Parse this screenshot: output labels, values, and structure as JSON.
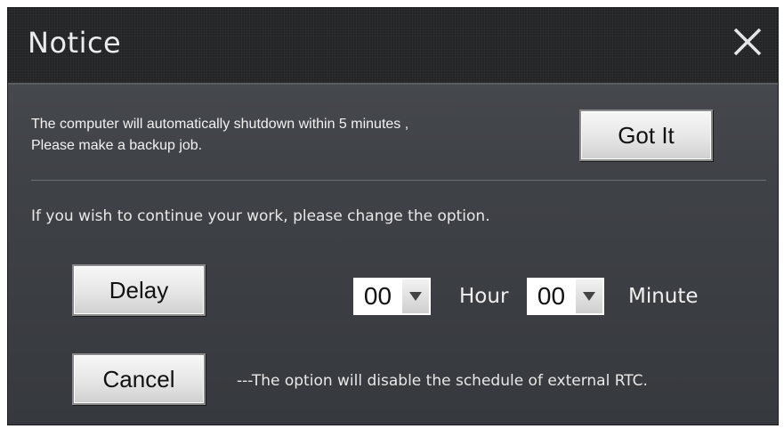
{
  "dialog": {
    "title": "Notice",
    "close_icon": "close-icon"
  },
  "message": {
    "line1": "The computer will automatically shutdown within 5 minutes ,",
    "line2": "Please make a backup job.",
    "got_it_label": "Got It"
  },
  "option_text": "If you wish to continue your work, please change the option.",
  "delay": {
    "button_label": "Delay",
    "hour_value": "00",
    "hour_label": "Hour",
    "minute_value": "00",
    "minute_label": "Minute",
    "dropdown_icon": "triangle-down-icon"
  },
  "cancel": {
    "button_label": "Cancel",
    "note": "---The option will disable the schedule of external RTC."
  },
  "colors": {
    "dialog_background": "#3f4247",
    "titlebar_background": "#222426",
    "button_background": "#e6e6e6",
    "text": "#f2f2f2"
  }
}
